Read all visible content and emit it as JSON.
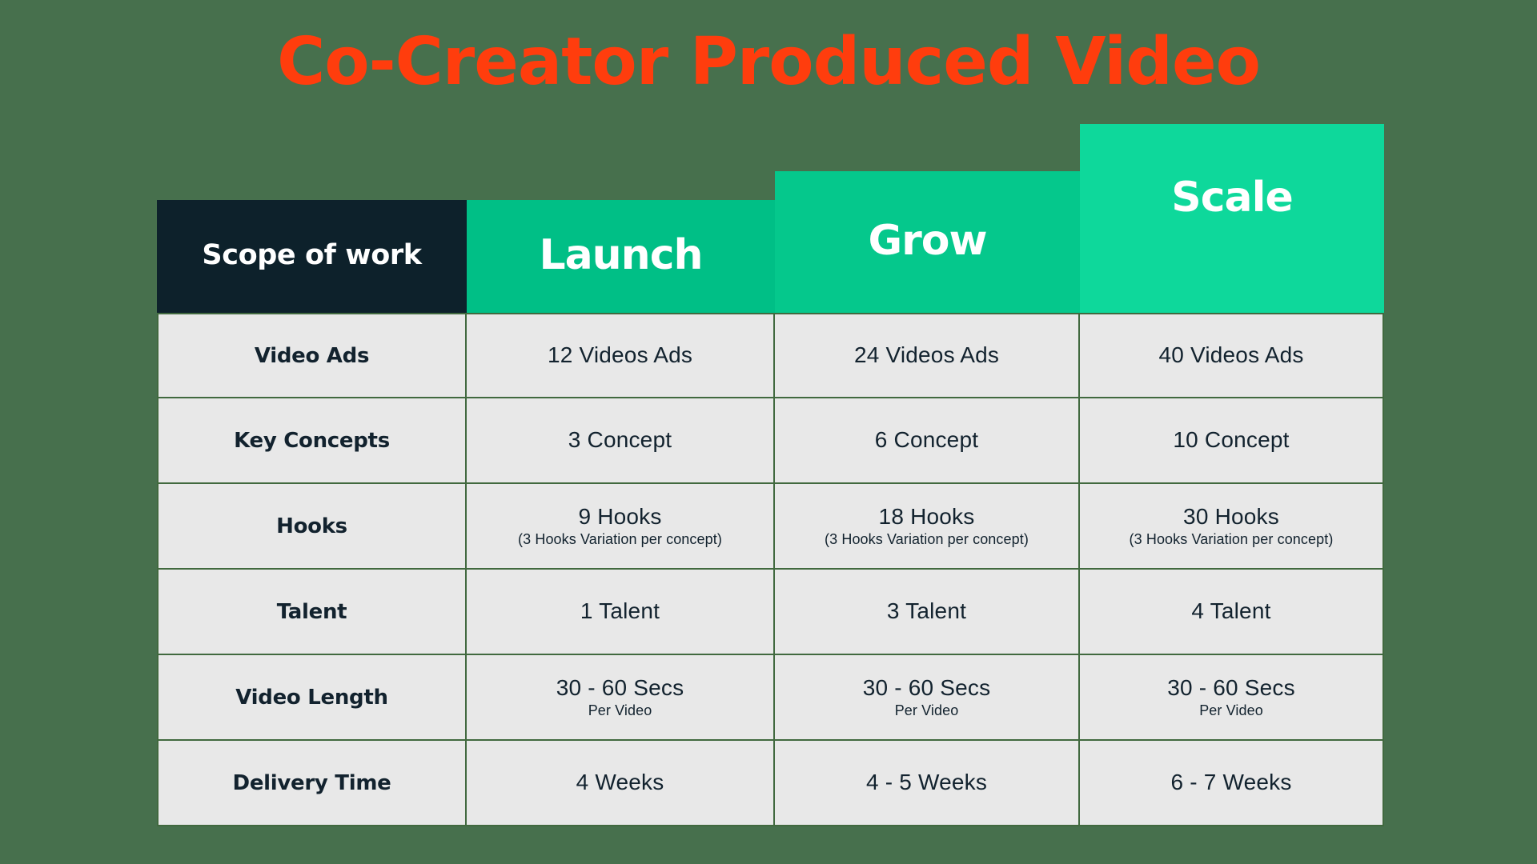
{
  "page": {
    "background_color": "#47704d",
    "title": "Co-Creator Produced Video",
    "title_color": "#FF3D0D"
  },
  "table": {
    "columns": [
      {
        "key": "scope",
        "label": "Scope of work",
        "header_color": "#0d212b"
      },
      {
        "key": "launch",
        "label": "Launch",
        "header_color": "#00bf86"
      },
      {
        "key": "grow",
        "label": "Grow",
        "header_color": "#05c88c"
      },
      {
        "key": "scale",
        "label": "Scale",
        "header_color": "#0ed89b"
      }
    ],
    "body_cell_color": "#e8e8e8",
    "border_color": "#41693f",
    "text_color": "#12222e",
    "rows": [
      {
        "label": "Video Ads",
        "launch": {
          "value": "12 Videos Ads",
          "sub": ""
        },
        "grow": {
          "value": "24 Videos Ads",
          "sub": ""
        },
        "scale": {
          "value": "40 Videos Ads",
          "sub": ""
        }
      },
      {
        "label": "Key Concepts",
        "launch": {
          "value": "3 Concept",
          "sub": ""
        },
        "grow": {
          "value": "6 Concept",
          "sub": ""
        },
        "scale": {
          "value": "10 Concept",
          "sub": ""
        }
      },
      {
        "label": "Hooks",
        "launch": {
          "value": "9 Hooks",
          "sub": "(3 Hooks Variation per concept)"
        },
        "grow": {
          "value": "18 Hooks",
          "sub": "(3 Hooks Variation per concept)"
        },
        "scale": {
          "value": "30 Hooks",
          "sub": "(3 Hooks Variation per concept)"
        }
      },
      {
        "label": "Talent",
        "launch": {
          "value": "1 Talent",
          "sub": ""
        },
        "grow": {
          "value": "3 Talent",
          "sub": ""
        },
        "scale": {
          "value": "4 Talent",
          "sub": ""
        }
      },
      {
        "label": "Video Length",
        "launch": {
          "value": "30 - 60 Secs",
          "sub": "Per Video"
        },
        "grow": {
          "value": "30 - 60 Secs",
          "sub": "Per Video"
        },
        "scale": {
          "value": "30 - 60 Secs",
          "sub": "Per Video"
        }
      },
      {
        "label": "Delivery Time",
        "launch": {
          "value": "4 Weeks",
          "sub": ""
        },
        "grow": {
          "value": "4 - 5 Weeks",
          "sub": ""
        },
        "scale": {
          "value": "6 - 7 Weeks",
          "sub": ""
        }
      }
    ]
  }
}
